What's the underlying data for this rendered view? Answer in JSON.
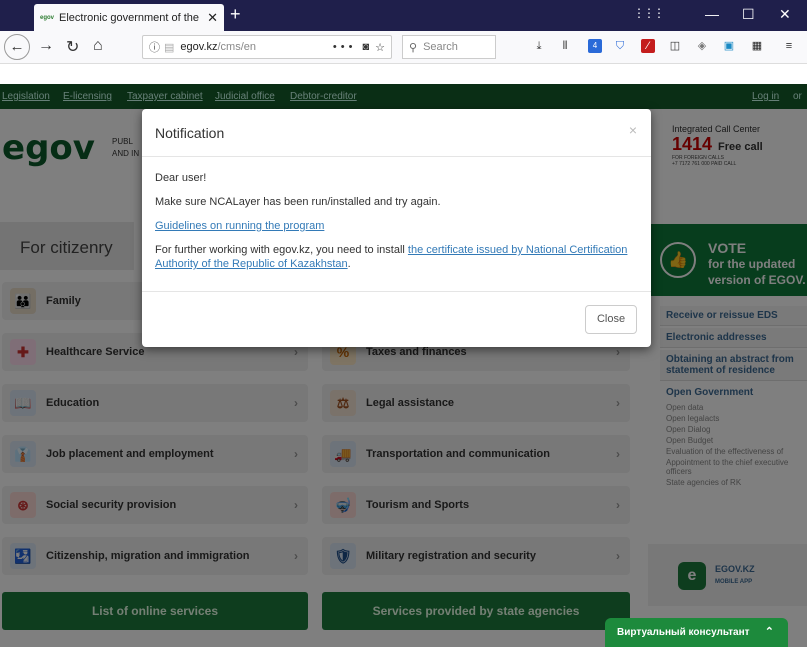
{
  "browser": {
    "tab_title": "Electronic government of the R",
    "tab_favicon": "egov",
    "tab_close": "✕",
    "new_tab": "+",
    "url_host": "egov.kz",
    "url_path": "/cms/en",
    "url_actions": "•••",
    "search_placeholder": "Search",
    "badge_count": "4"
  },
  "site": {
    "top_links": [
      "Legislation",
      "E-licensing",
      "Taxpayer cabinet",
      "Judicial office",
      "Debtor-creditor"
    ],
    "login": "Log in",
    "or": "or",
    "logo_e": "e",
    "logo_rest": "gov",
    "logo_sub_1": "PUBL",
    "logo_sub_2": "AND IN",
    "call_title": "Integrated Call Center",
    "call_number": "1414",
    "call_free": "Free call",
    "call_small_1": "FOR FOREIGN CALLS",
    "call_small_2": "+7 7172 761 000 PAID CALL",
    "citizen_tab": "For citizenry",
    "vote_1": "VOTE",
    "vote_2": "for the updated",
    "vote_3": "version of EGOV.",
    "services_left": [
      "Family",
      "Healthcare Service",
      "Education",
      "Job placement and employment",
      "Social security provision",
      "Citizenship, migration and immigration"
    ],
    "services_right": [
      "Taxes and finances",
      "Legal assistance",
      "Transportation and communication",
      "Tourism and Sports",
      "Military registration and security"
    ],
    "btn_online": "List of online services",
    "btn_agencies": "Services provided by state agencies",
    "side_links": [
      "Receive or reissue EDS",
      "Electronic addresses",
      "Obtaining an abstract from statement of residence"
    ],
    "open_gov": "Open Government",
    "open_gov_items": [
      "Open data",
      "Open legalacts",
      "Open Dialog",
      "Open Budget",
      "Evaluation of the effectiveness of",
      "Appointment to the chief executive officers",
      "State agencies of RK"
    ],
    "app_title": "EGOV.KZ",
    "app_sub": "MOBILE APP"
  },
  "modal": {
    "title": "Notification",
    "close_x": "×",
    "greeting": "Dear user!",
    "msg1": "Make sure NCALayer has been run/installed and try again.",
    "guideline_link": "Guidelines on running the program",
    "msg2_prefix": "For further working with egov.kz, you need to install ",
    "cert_link": "the certificate issued by National Certification Authority of the Republic of Kazakhstan",
    "msg2_suffix": ".",
    "close_button": "Close"
  },
  "consultant": {
    "label": "Виртуальный консультант",
    "toggle": "⌃"
  }
}
